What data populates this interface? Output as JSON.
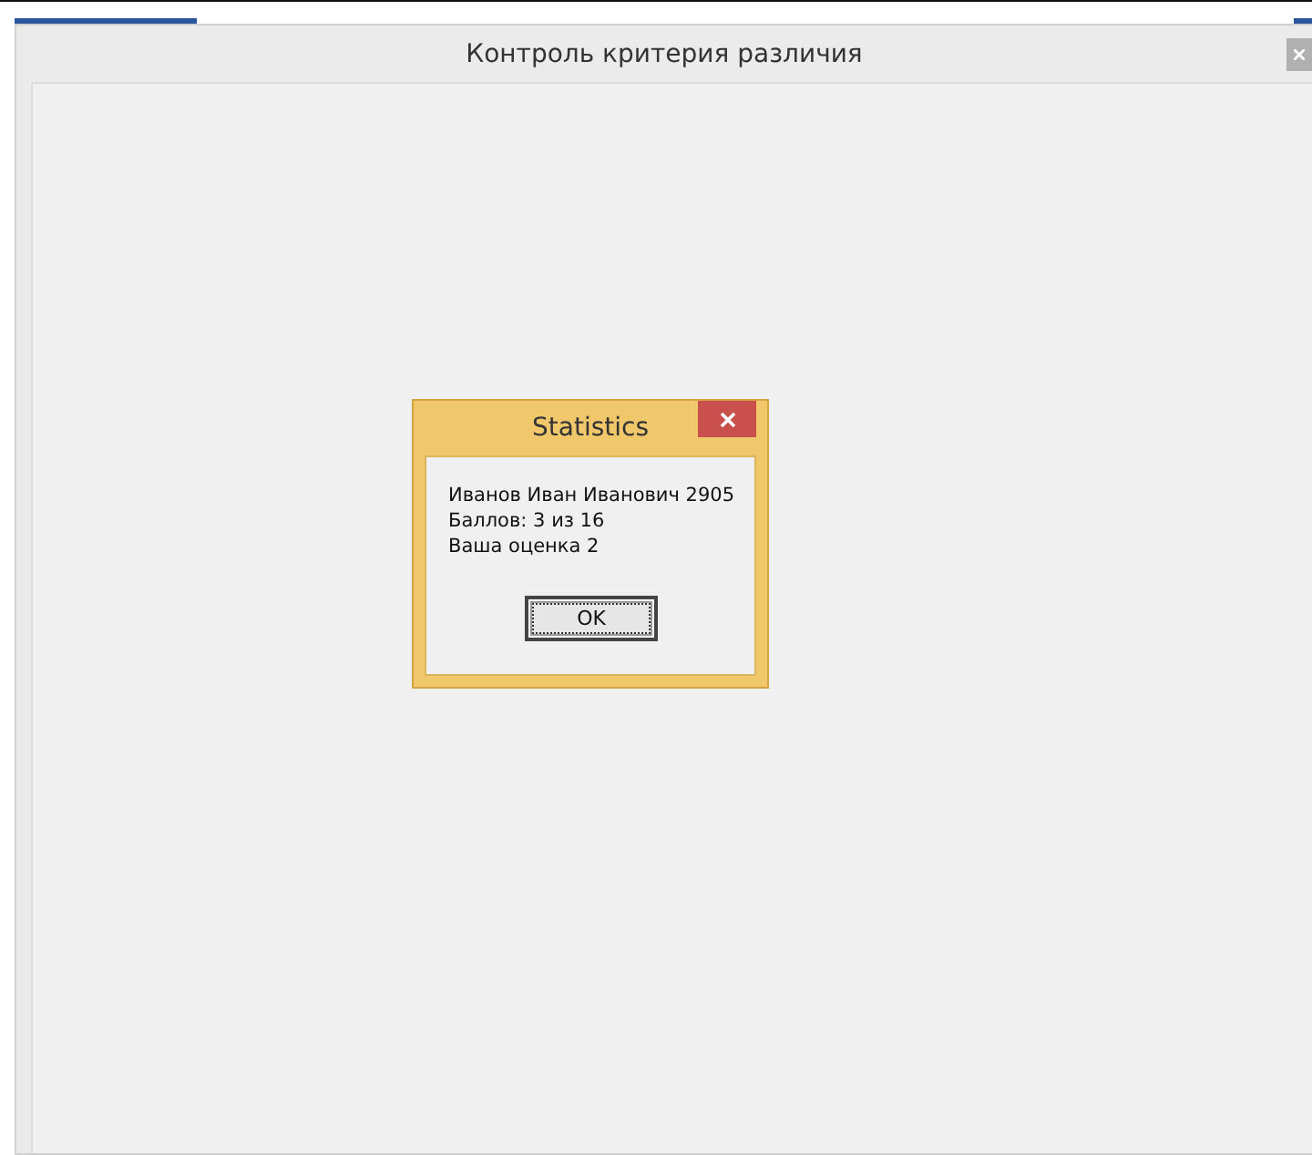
{
  "window": {
    "title": "Контроль критерия различия"
  },
  "dialog": {
    "title": "Statistics",
    "lines": [
      "Иванов Иван Иванович 2905",
      "Баллов: 3 из 16",
      "Ваша оценка 2"
    ],
    "button": "OK"
  }
}
